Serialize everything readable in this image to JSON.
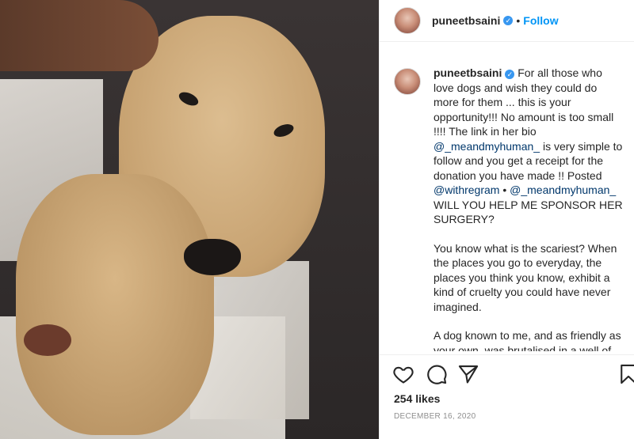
{
  "post": {
    "username": "puneetbsaini",
    "follow_label": "Follow",
    "dot": "•",
    "caption_lead": "For all those who love dogs and wish they could do more for them ... this is your opportunity!!! No amount is too small !!!! The link in her bio",
    "mention1": "@_meandmyhuman_",
    "caption_mid": "is very simple to follow and you get a receipt for the donation you have made !! Posted",
    "mention2": "@withregram",
    "caption_dot": "•",
    "mention3": "@_meandmyhuman_",
    "caption_tail": "WILL YOU HELP ME SPONSOR HER SURGERY?",
    "para2": "You know what is the scariest? When the places you go to everyday, the places you think you know, exhibit a kind of cruelty you could have never imagined.",
    "para3": "A dog known to me, and as friendly as your own, was brutalised in a well of sector of Faridabad. When her photos",
    "likes": "254 likes",
    "date": "DECEMBER 16, 2020"
  },
  "icons": [
    "heart-icon",
    "comment-icon",
    "share-icon",
    "bookmark-icon",
    "verified-badge-icon"
  ]
}
